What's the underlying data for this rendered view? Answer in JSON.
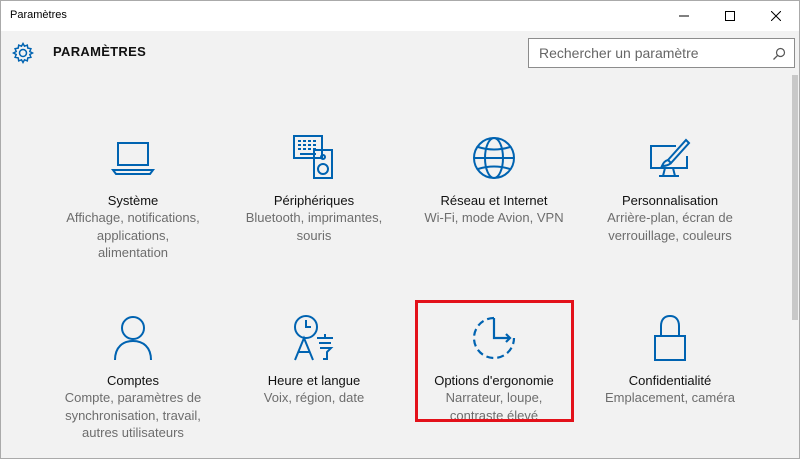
{
  "window": {
    "title": "Paramètres"
  },
  "header": {
    "app_title": "PARAMÈTRES",
    "search_placeholder": "Rechercher un paramètre"
  },
  "colors": {
    "accent": "#0063b1",
    "highlight": "#e3111a",
    "description_text": "#6d6d6d"
  },
  "tiles": [
    {
      "icon": "laptop-icon",
      "name": "Système",
      "desc": [
        "Affichage, notifications,",
        "applications,",
        "alimentation"
      ]
    },
    {
      "icon": "devices-icon",
      "name": "Périphériques",
      "desc": [
        "Bluetooth, imprimantes,",
        "souris"
      ]
    },
    {
      "icon": "globe-icon",
      "name": "Réseau et Internet",
      "desc": [
        "Wi-Fi, mode Avion, VPN"
      ]
    },
    {
      "icon": "personalization-icon",
      "name": "Personnalisation",
      "desc": [
        "Arrière-plan, écran de",
        "verrouillage, couleurs"
      ]
    },
    {
      "icon": "person-icon",
      "name": "Comptes",
      "desc": [
        "Compte, paramètres de",
        "synchronisation, travail,",
        "autres utilisateurs"
      ]
    },
    {
      "icon": "time-language-icon",
      "name": "Heure et langue",
      "desc": [
        "Voix, région, date"
      ]
    },
    {
      "icon": "ease-of-access-icon",
      "name": "Options d'ergonomie",
      "desc": [
        "Narrateur, loupe,",
        "contraste élevé"
      ]
    },
    {
      "icon": "lock-icon",
      "name": "Confidentialité",
      "desc": [
        "Emplacement, caméra"
      ]
    }
  ]
}
